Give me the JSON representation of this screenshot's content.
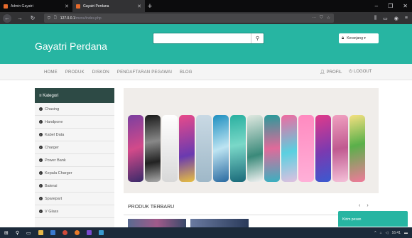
{
  "browser": {
    "tabs": [
      {
        "title": "Admin Gayatri",
        "active": false
      },
      {
        "title": "Gayatri Perdana",
        "active": true
      }
    ],
    "url_host": "127.0.0.1",
    "url_path": "/menu/index.php",
    "newtab_label": "+"
  },
  "site": {
    "brand": "Gayatri Perdana",
    "search": {
      "placeholder": "",
      "value": ""
    },
    "cart_label": "Keranjang ▾",
    "menu_left": [
      "HOME",
      "PRODUK",
      "DISKON",
      "PENDAFTARAN PEGAWAI",
      "BLOG"
    ],
    "menu_right": {
      "profil": "PROFIL",
      "logout": "LOGOUT"
    }
  },
  "sidebar": {
    "title": "≡ Kategori",
    "items": [
      "Chasing",
      "Handpone",
      "Kabel Data",
      "Charger",
      "Power Bank",
      "Kepala Charger",
      "Baterai",
      "Sparepart",
      "V Glass"
    ]
  },
  "products": {
    "title": "PRODUK TERBARU",
    "prev": "‹",
    "next": "›"
  },
  "chat": {
    "label": "Kirim pesan"
  },
  "taskbar": {
    "time": "16:41"
  },
  "colors": {
    "brand": "#27b5a2",
    "sidebar_head": "#2d4a45"
  }
}
